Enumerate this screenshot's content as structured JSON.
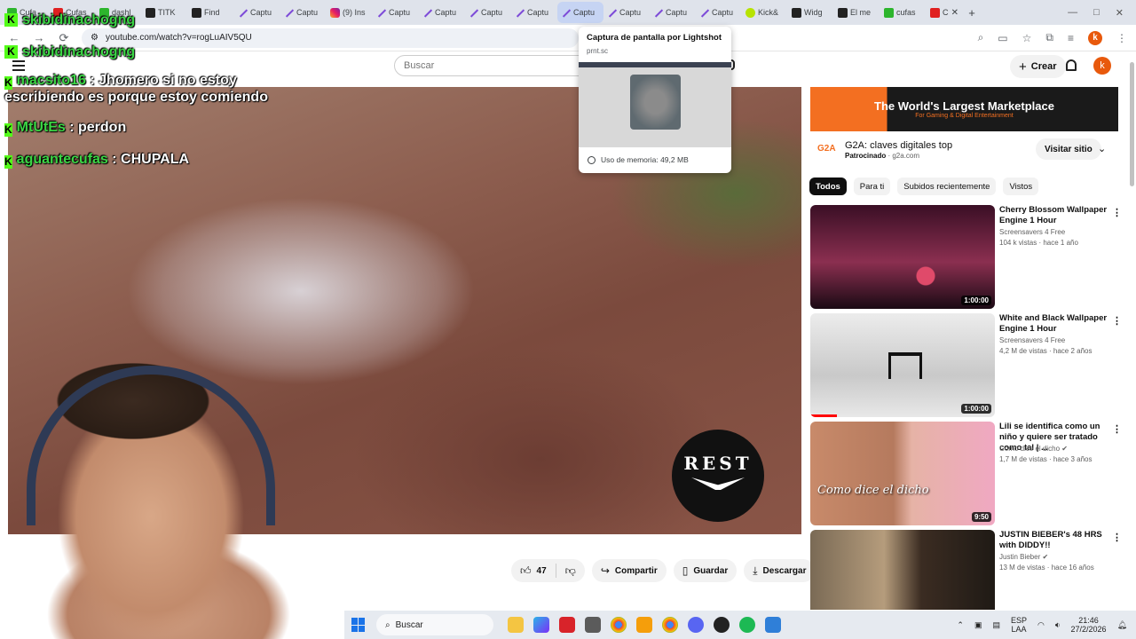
{
  "browser": {
    "tabs": [
      {
        "label": "Cufa",
        "favicon": "kick-icon",
        "active": false
      },
      {
        "label": "Cufas",
        "favicon": "youtube-icon",
        "active": false
      },
      {
        "label": "dashl",
        "favicon": "kick-icon",
        "active": false
      },
      {
        "label": "TITK",
        "favicon": "tiktok-icon",
        "active": false
      },
      {
        "label": "Find",
        "favicon": "dark-icon",
        "active": false
      },
      {
        "label": "Captu",
        "favicon": "lightshot-icon",
        "active": false
      },
      {
        "label": "Captu",
        "favicon": "lightshot-icon",
        "active": false
      },
      {
        "label": "(9) Ins",
        "favicon": "instagram-icon",
        "active": false
      },
      {
        "label": "Captu",
        "favicon": "lightshot-icon",
        "active": false
      },
      {
        "label": "Captu",
        "favicon": "lightshot-icon",
        "active": false
      },
      {
        "label": "Captu",
        "favicon": "lightshot-icon",
        "active": false
      },
      {
        "label": "Captu",
        "favicon": "lightshot-icon",
        "active": false
      },
      {
        "label": "Captu",
        "favicon": "lightshot-icon",
        "active": true
      },
      {
        "label": "Captu",
        "favicon": "lightshot-icon",
        "active": false
      },
      {
        "label": "Captu",
        "favicon": "lightshot-icon",
        "active": false
      },
      {
        "label": "Captu",
        "favicon": "lightshot-icon",
        "active": false
      },
      {
        "label": "Kick&",
        "favicon": "lime-icon",
        "active": false
      },
      {
        "label": "Widg",
        "favicon": "dark-icon",
        "active": false
      },
      {
        "label": "El me",
        "favicon": "dark-icon",
        "active": false
      },
      {
        "label": "cufas",
        "favicon": "kick-icon",
        "active": false
      },
      {
        "label": "C",
        "favicon": "youtube-icon",
        "active": false
      }
    ],
    "new_tab": "+",
    "window_controls": [
      "—",
      "□",
      "✕"
    ],
    "url": "youtube.com/watch?v=rogLuAIV5QU",
    "back": "←",
    "forward": "→",
    "reload": "⟳",
    "profile_initial": "k"
  },
  "tooltip": {
    "title": "Captura de pantalla por Lightshot",
    "url": "prnt.sc",
    "memory": "Uso de memoria: 49,2 MB"
  },
  "youtube": {
    "search_placeholder": "Buscar",
    "create_label": "Crear",
    "avatar_initial": "k",
    "video": {
      "logo_text": "REST",
      "likes": "47",
      "share_label": "Compartir",
      "save_label": "Guardar",
      "download_label": "Descargar",
      "more": "•••"
    },
    "ad": {
      "banner_title": "The World's Largest Marketplace",
      "banner_sub": "For Gaming & Digital Entertainment",
      "brand": "G2A",
      "title": "G2A: claves digitales top",
      "sponsored": "Patrocinado",
      "domain": "g2a.com",
      "visit_label": "Visitar sitio"
    },
    "chips": [
      "Todos",
      "Para ti",
      "Subidos recientemente",
      "Vistos"
    ],
    "recommendations": [
      {
        "title": "Cherry Blossom Wallpaper Engine 1 Hour",
        "channel": "Screensavers 4 Free",
        "meta": "104 k vistas · hace 1 año",
        "duration": "1:00:00",
        "verified": false
      },
      {
        "title": "White and Black Wallpaper Engine 1 Hour",
        "channel": "Screensavers 4 Free",
        "meta": "4,2 M de vistas · hace 2 años",
        "duration": "1:00:00",
        "verified": false
      },
      {
        "title": "Lili se identifica como un niño y quiere ser tratado como tal | ...",
        "channel": "Como dice el dicho",
        "meta": "1,7 M de vistas · hace 3 años",
        "duration": "9:50",
        "verified": true,
        "thumb_text": "Como dice el dicho"
      },
      {
        "title": "JUSTIN BIEBER's 48 HRS with DIDDY!!",
        "channel": "Justin Bieber",
        "meta": "13 M de vistas · hace 16 años",
        "duration": "",
        "verified": true
      }
    ]
  },
  "chat": {
    "top_lines": [
      {
        "name": "skibidinachogng",
        "message": ""
      },
      {
        "name": "skibidinachogng",
        "message": ""
      }
    ],
    "lines": [
      {
        "name": "macsito16",
        "message": "Jhomero si no estoy escribiendo es porque estoy comiendo"
      },
      {
        "name": "MtUtEs",
        "message": "perdon"
      },
      {
        "name": "aguantecufas",
        "message": "CHUPALA"
      }
    ]
  },
  "taskbar": {
    "search_label": "Buscar",
    "language": "ESP",
    "language_sub": "LAA",
    "time": "21:46",
    "date": "27/2/2026"
  }
}
